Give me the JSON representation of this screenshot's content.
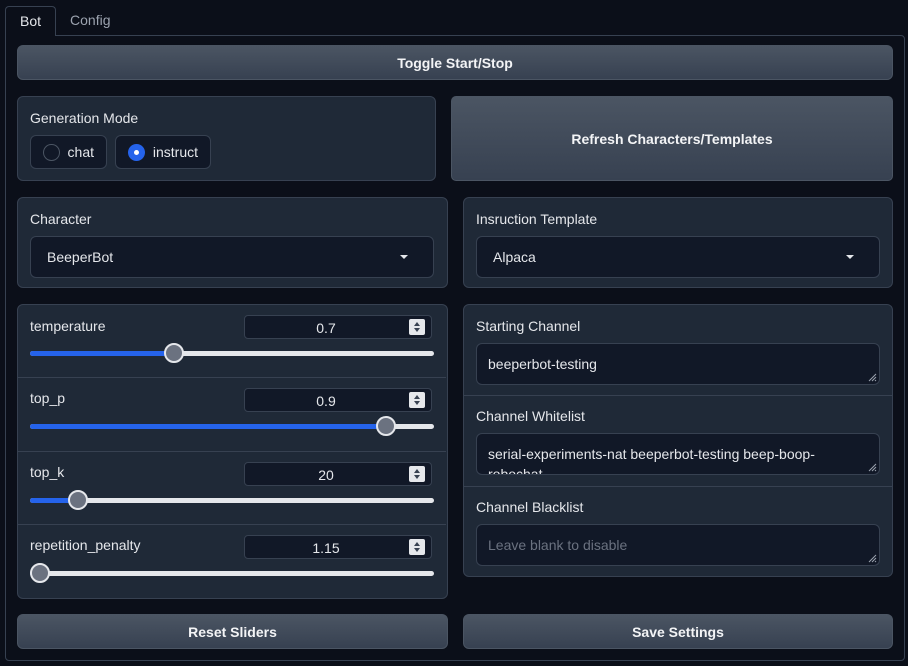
{
  "tabs": [
    {
      "label": "Bot",
      "active": true
    },
    {
      "label": "Config",
      "active": false
    }
  ],
  "toggle_button": "Toggle Start/Stop",
  "generation_mode": {
    "label": "Generation Mode",
    "options": [
      {
        "label": "chat",
        "selected": false
      },
      {
        "label": "instruct",
        "selected": true
      }
    ]
  },
  "refresh_button": "Refresh Characters/Templates",
  "character": {
    "label": "Character",
    "value": "BeeperBot"
  },
  "instruction_template": {
    "label": "Insruction Template",
    "value": "Alpaca"
  },
  "sliders": [
    {
      "name": "temperature",
      "value": "0.7",
      "fraction": 0.356
    },
    {
      "name": "top_p",
      "value": "0.9",
      "fraction": 0.88
    },
    {
      "name": "top_k",
      "value": "20",
      "fraction": 0.119
    },
    {
      "name": "repetition_penalty",
      "value": "1.15",
      "fraction": 0.025
    }
  ],
  "starting_channel": {
    "label": "Starting Channel",
    "value": "beeperbot-testing"
  },
  "channel_whitelist": {
    "label": "Channel Whitelist",
    "value": "serial-experiments-nat beeperbot-testing beep-boop-robochat"
  },
  "channel_blacklist": {
    "label": "Channel Blacklist",
    "value": "",
    "placeholder": "Leave blank to disable"
  },
  "reset_button": "Reset Sliders",
  "save_button": "Save Settings",
  "colors": {
    "accent": "#2563eb",
    "background": "#0b0f19",
    "panel": "#1f2937"
  }
}
